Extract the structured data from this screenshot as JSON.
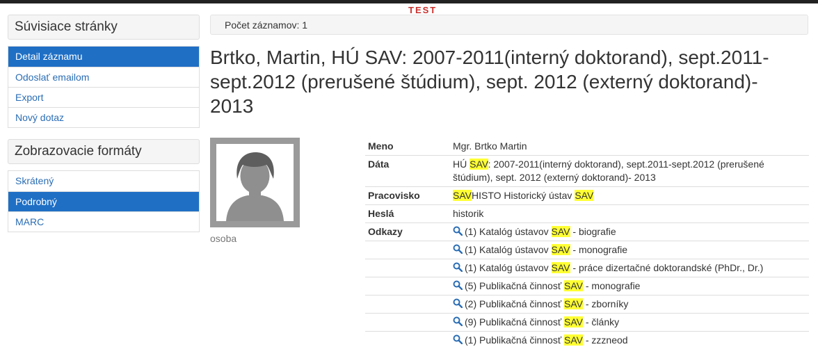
{
  "banner": {
    "test_label": "TEST"
  },
  "sidebar": {
    "related_title": "Súvisiace stránky",
    "related_items": [
      {
        "label": "Detail záznamu",
        "active": true
      },
      {
        "label": "Odoslať emailom",
        "active": false
      },
      {
        "label": "Export",
        "active": false
      },
      {
        "label": "Nový dotaz",
        "active": false
      }
    ],
    "formats_title": "Zobrazovacie formáty",
    "format_items": [
      {
        "label": "Skrátený",
        "active": false
      },
      {
        "label": "Podrobný",
        "active": true
      },
      {
        "label": "MARC",
        "active": false
      }
    ]
  },
  "main": {
    "record_count": "Počet záznamov: 1",
    "title": "Brtko, Martin, HÚ SAV: 2007-2011(interný doktorand), sept.2011-sept.2012 (prerušené štúdium), sept. 2012 (externý doktorand)- 2013",
    "avatar_caption": "osoba",
    "fields": {
      "meno_label": "Meno",
      "meno_value": "Mgr. Brtko Martin",
      "data_label": "Dáta",
      "data_pre": "HÚ ",
      "data_hl": "SAV",
      "data_post": ": 2007-2011(interný doktorand), sept.2011-sept.2012 (prerušené štúdium), sept. 2012 (externý doktorand)- 2013",
      "pracovisko_label": "Pracovisko",
      "pracovisko_hl1": "SAV",
      "pracovisko_mid": "HISTO Historický ústav ",
      "pracovisko_hl2": "SAV",
      "hesla_label": "Heslá",
      "hesla_value": "historik",
      "odkazy_label": "Odkazy"
    },
    "links": [
      {
        "pre": "(1) Katalóg ústavov ",
        "hl": "SAV",
        "post": " - biografie"
      },
      {
        "pre": "(1) Katalóg ústavov ",
        "hl": "SAV",
        "post": " - monografie"
      },
      {
        "pre": "(1) Katalóg ústavov ",
        "hl": "SAV",
        "post": " - práce dizertačné doktorandské (PhDr., Dr.)"
      },
      {
        "pre": "(5) Publikačná činnosť ",
        "hl": "SAV",
        "post": " - monografie"
      },
      {
        "pre": "(2) Publikačná činnosť ",
        "hl": "SAV",
        "post": " - zborníky"
      },
      {
        "pre": "(9) Publikačná činnosť ",
        "hl": "SAV",
        "post": " - články"
      },
      {
        "pre": "(1) Publikačná činnosť ",
        "hl": "SAV",
        "post": " - zzzneod"
      }
    ],
    "colors": {
      "accent": "#1f6fc5",
      "highlight": "#ffff33",
      "link": "#2a6db5"
    }
  }
}
